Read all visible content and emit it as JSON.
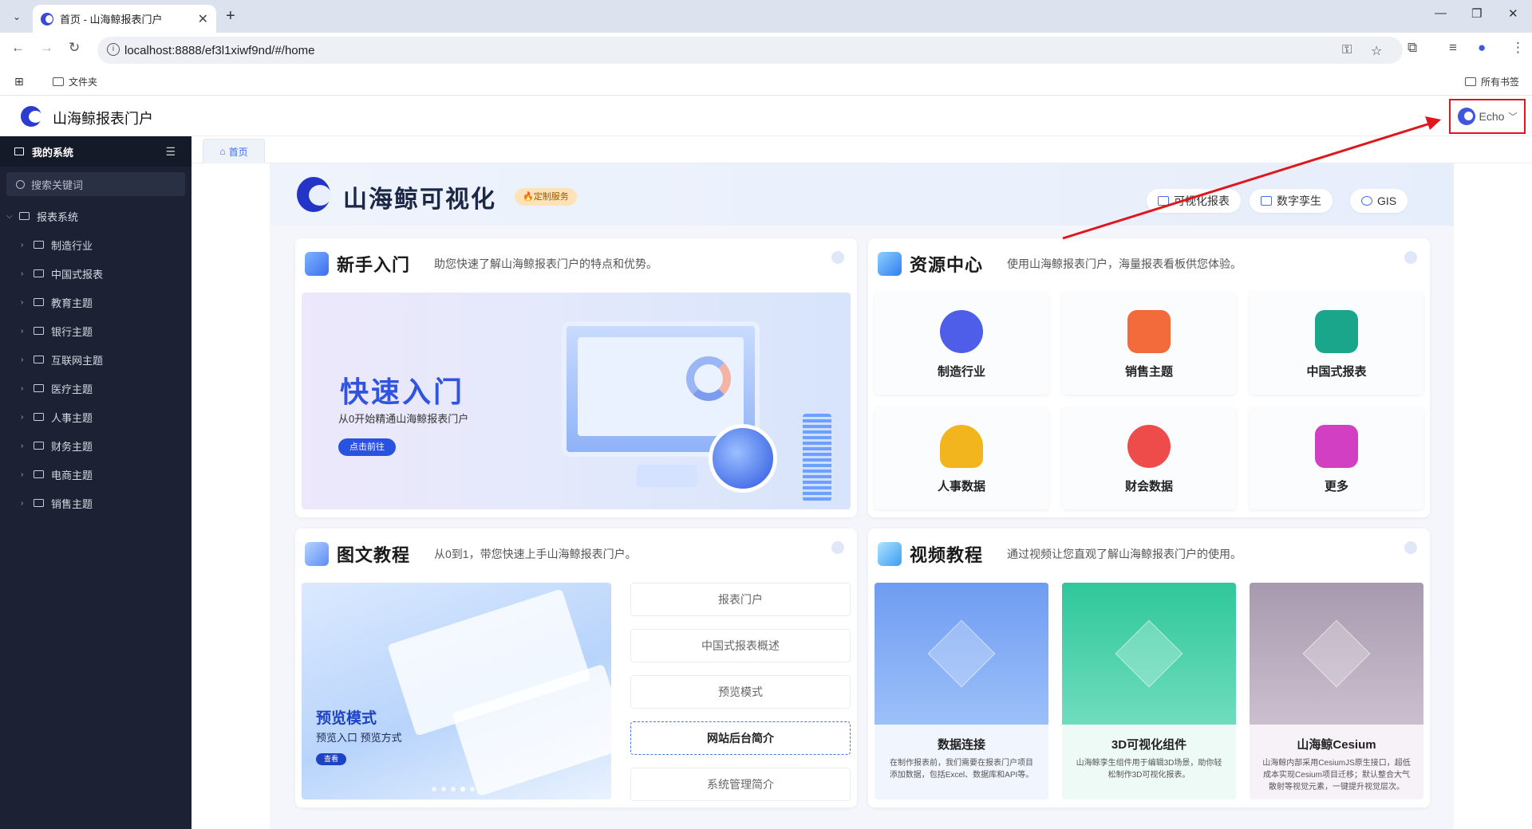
{
  "browser": {
    "tab_title": "首页 - 山海鲸报表门户",
    "url": "localhost:8888/ef3l1xiwf9nd/#/home",
    "bookmarks_left": "文件夹",
    "bookmarks_right": "所有书签"
  },
  "app": {
    "title": "山海鲸报表门户",
    "user_name": "Echo"
  },
  "sidebar": {
    "header": "我的系统",
    "search_placeholder": "搜索关键词",
    "root": "报表系统",
    "items": [
      {
        "label": "制造行业"
      },
      {
        "label": "中国式报表"
      },
      {
        "label": "教育主题"
      },
      {
        "label": "银行主题"
      },
      {
        "label": "互联网主题"
      },
      {
        "label": "医疗主题"
      },
      {
        "label": "人事主题"
      },
      {
        "label": "财务主题"
      },
      {
        "label": "电商主题"
      },
      {
        "label": "销售主题"
      }
    ]
  },
  "breadcrumb": {
    "home": "首页"
  },
  "hero": {
    "title": "山海鲸可视化",
    "badge": "🔥定制服务",
    "buttons": [
      {
        "label": "可视化报表"
      },
      {
        "label": "数字孪生"
      },
      {
        "label": "GIS"
      }
    ]
  },
  "beginner": {
    "title": "新手入门",
    "subtitle": "助您快速了解山海鲸报表门户的特点和优势。",
    "banner_title": "快速入门",
    "banner_sub": "从0开始精通山海鲸报表门户",
    "banner_btn": "点击前往"
  },
  "resources": {
    "title": "资源中心",
    "subtitle": "使用山海鲸报表门户，海量报表看板供您体验。",
    "tiles": [
      {
        "label": "制造行业",
        "color": "#4f5ee8"
      },
      {
        "label": "销售主题",
        "color": "#f36b3b"
      },
      {
        "label": "中国式报表",
        "color": "#1aa68a"
      },
      {
        "label": "人事数据",
        "color": "#f3b51d"
      },
      {
        "label": "财会数据",
        "color": "#ee4b4b"
      },
      {
        "label": "更多",
        "color": "#d33fc2"
      }
    ]
  },
  "tutorial": {
    "title": "图文教程",
    "subtitle": "从0到1，带您快速上手山海鲸报表门户。",
    "img_title": "预览模式",
    "img_sub": "预览入口  预览方式",
    "img_btn": "查看",
    "links": [
      {
        "label": "报表门户"
      },
      {
        "label": "中国式报表概述"
      },
      {
        "label": "预览模式"
      },
      {
        "label": "网站后台简介"
      },
      {
        "label": "系统管理简介"
      }
    ]
  },
  "video": {
    "title": "视频教程",
    "subtitle": "通过视频让您直观了解山海鲸报表门户的使用。",
    "items": [
      {
        "title": "数据连接",
        "desc": "在制作报表前，我们需要在报表门户项目添加数据，包括Excel、数据库和API等。",
        "color": "#6f9cf2"
      },
      {
        "title": "3D可视化组件",
        "desc": "山海鲸孪生组件用于编辑3D场景，助你轻松制作3D可视化报表。",
        "color": "#3bc9a2"
      },
      {
        "title": "山海鲸Cesium",
        "desc": "山海鲸内部采用CesiumJS原生接口，超低成本实现Cesium项目迁移；默认整合大气散射等视觉元素，一键提升视觉层次。",
        "color": "#b4a7b8"
      }
    ]
  }
}
